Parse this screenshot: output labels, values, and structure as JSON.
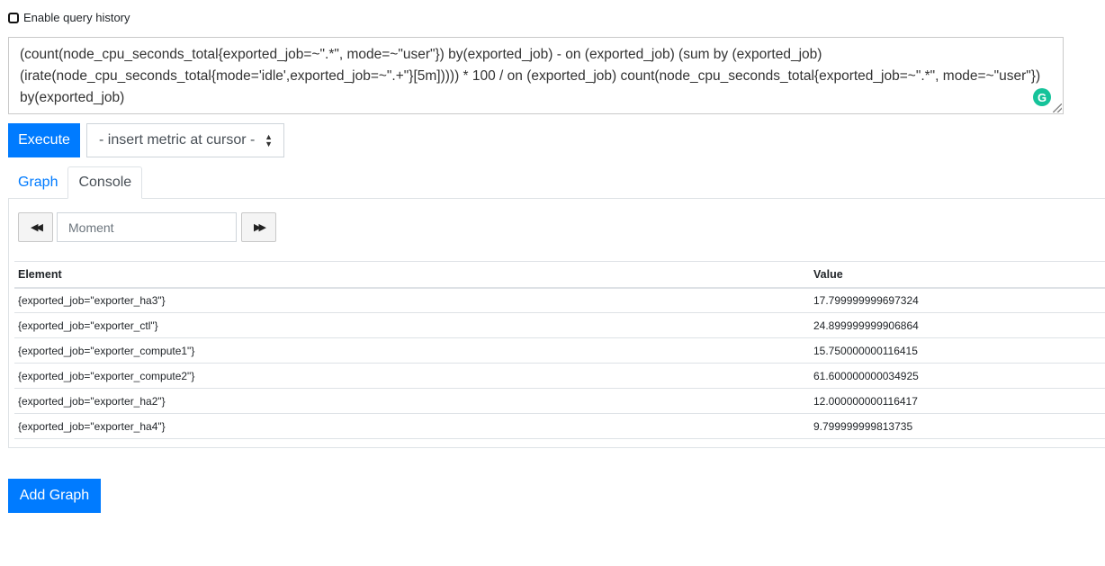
{
  "history": {
    "label": "Enable query history"
  },
  "query": {
    "expression": "(count(node_cpu_seconds_total{exported_job=~\".*\", mode=~\"user\"}) by(exported_job) - on (exported_job) (sum by (exported_job) (irate(node_cpu_seconds_total{mode='idle',exported_job=~\".+\"}[5m])))) * 100 / on (exported_job) count(node_cpu_seconds_total{exported_job=~\".*\", mode=~\"user\"}) by(exported_job)"
  },
  "toolbar": {
    "execute_label": "Execute",
    "metric_select_label": "- insert metric at cursor -"
  },
  "tabs": [
    {
      "label": "Graph",
      "active": false
    },
    {
      "label": "Console",
      "active": true
    }
  ],
  "console": {
    "moment_placeholder": "Moment"
  },
  "results": {
    "headers": [
      "Element",
      "Value"
    ],
    "rows": [
      {
        "element": "{exported_job=\"exporter_ha3\"}",
        "value": "17.799999999697324"
      },
      {
        "element": "{exported_job=\"exporter_ctl\"}",
        "value": "24.899999999906864"
      },
      {
        "element": "{exported_job=\"exporter_compute1\"}",
        "value": "15.750000000116415"
      },
      {
        "element": "{exported_job=\"exporter_compute2\"}",
        "value": "61.600000000034925"
      },
      {
        "element": "{exported_job=\"exporter_ha2\"}",
        "value": "12.000000000116417"
      },
      {
        "element": "{exported_job=\"exporter_ha4\"}",
        "value": "9.799999999813735"
      }
    ]
  },
  "footer": {
    "add_graph_label": "Add Graph"
  },
  "colors": {
    "primary": "#007bff",
    "grammarly": "#15c39a"
  },
  "icons": {
    "back": "fast-backward-icon",
    "forward": "fast-forward-icon",
    "grammarly": "grammarly-icon",
    "select": "sort-arrows-icon"
  }
}
